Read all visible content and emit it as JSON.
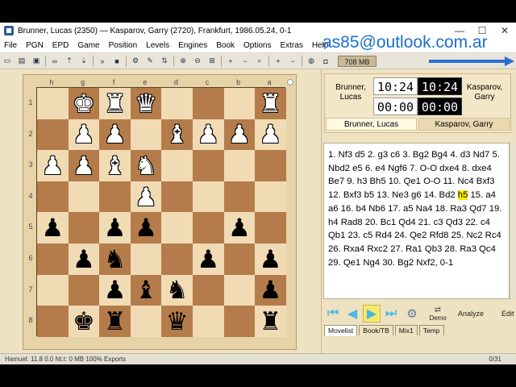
{
  "window": {
    "title": "Brunner, Lucas (2350)  —  Kasparov, Garry (2720),  Frankfurt,  1986.05.24,  0-1",
    "minimize": "—",
    "maximize": "☐",
    "close": "✕"
  },
  "overlay_text": "as85@outlook.com.ar",
  "menu": [
    "File",
    "PGN",
    "EPD",
    "Game",
    "Position",
    "Levels",
    "Engines",
    "Book",
    "Options",
    "Extras",
    "Help"
  ],
  "toolbar": {
    "memory": "708 MB"
  },
  "board": {
    "files": [
      "h",
      "g",
      "f",
      "e",
      "d",
      "c",
      "b",
      "a"
    ],
    "ranks": [
      "1",
      "2",
      "3",
      "4",
      "5",
      "6",
      "7",
      "8"
    ],
    "squares": [
      [
        "",
        "wK",
        "wR",
        "wQ",
        "",
        "",
        "",
        "wR"
      ],
      [
        "",
        "wP",
        "wP",
        "",
        "wB",
        "wP",
        "wP",
        "wP"
      ],
      [
        "wP",
        "wP",
        "wB",
        "wN",
        "",
        "",
        "",
        ""
      ],
      [
        "",
        "",
        "",
        "wP",
        "",
        "",
        "",
        ""
      ],
      [
        "bP",
        "",
        "bP",
        "bP",
        "",
        "",
        "bP",
        ""
      ],
      [
        "",
        "bP",
        "bN",
        "",
        "",
        "bP",
        "",
        "bP"
      ],
      [
        "",
        "",
        "bP",
        "bB",
        "bN",
        "",
        "",
        "bP"
      ],
      [
        "",
        "bK",
        "bR",
        "",
        "bQ",
        "",
        "",
        "bR"
      ]
    ]
  },
  "players": {
    "white_name_line1": "Brunner,",
    "white_name_line2": "Lucas",
    "black_name_line1": "Kasparov,",
    "black_name_line2": "Garry",
    "white_clock_top": "10:24",
    "white_clock_bottom": "00:00",
    "black_clock_top": "10:24",
    "black_clock_bottom": "00:00",
    "white_bar": "Brunner, Lucas",
    "black_bar": "Kasparov, Garry"
  },
  "moves": {
    "before_highlight": "1. Nf3 d5 2. g3 c6 3. Bg2 Bg4 4. d3 Nd7 5. Nbd2 e5 6. e4 Ngf6 7. O-O dxe4 8. dxe4 Be7 9. h3 Bh5 10. Qe1 O-O 11. Nc4 Bxf3 12. Bxf3 b5 13. Ne3 g6 14. Bd2 ",
    "highlight": "h5",
    "after_highlight": " 15. a4 a6 16. b4 Nb6 17. a5 Na4 18. Ra3 Qd7 19. h4 Rad8 20. Bc1 Qd4 21. c3 Qd3 22. c4 Qb1 23. c5 Rd4 24. Qe2 Rfd8 25. Nc2 Rc4 26. Rxa4 Rxc2 27. Ra1 Qb3 28. Ra3 Qc4 29. Qe1 Ng4 30. Bg2 Nxf2, 0-1"
  },
  "nav": {
    "demo": "Demo",
    "analyze": "Analyze",
    "edit": "Edit"
  },
  "tabs": [
    "Movelist",
    "Book/TB",
    "Mix1",
    "Temp"
  ],
  "status": {
    "left": "Hamuel: 11.8 0.0 Nt.t: 0 MB    100%    Exports",
    "right": "0/31"
  }
}
